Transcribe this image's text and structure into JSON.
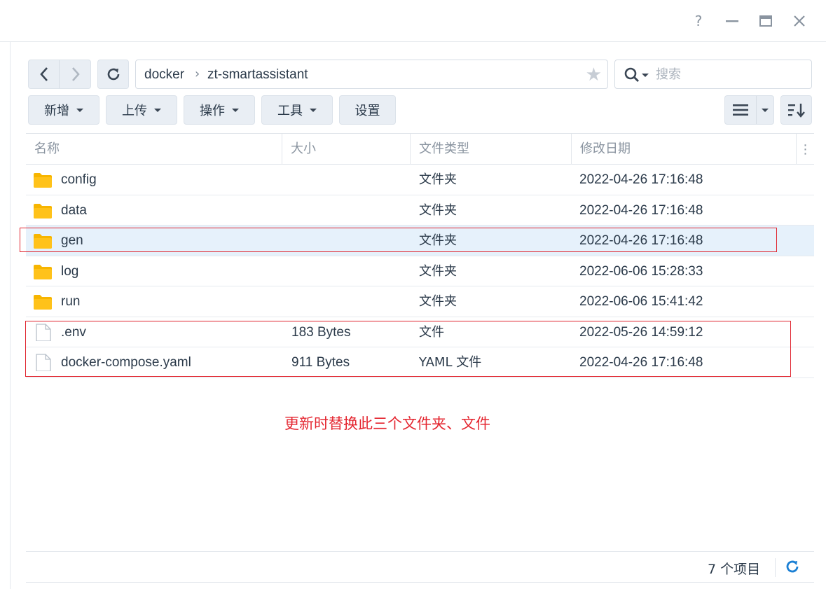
{
  "window": {
    "help_icon": "?",
    "minimize_icon": "minimize-icon",
    "maximize_icon": "maximize-icon",
    "close_icon": "close-icon"
  },
  "nav": {
    "path": [
      "docker",
      "zt-smartassistant"
    ],
    "path_separator": "›",
    "search_placeholder": "搜索"
  },
  "toolbar": {
    "buttons": [
      {
        "label": "新增",
        "dropdown": true
      },
      {
        "label": "上传",
        "dropdown": true
      },
      {
        "label": "操作",
        "dropdown": true
      },
      {
        "label": "工具",
        "dropdown": true
      },
      {
        "label": "设置",
        "dropdown": false
      }
    ]
  },
  "table": {
    "columns": [
      "名称",
      "大小",
      "文件类型",
      "修改日期"
    ],
    "rows": [
      {
        "name": "config",
        "size": "",
        "type": "文件夹",
        "date": "2022-04-26 17:16:48",
        "kind": "folder"
      },
      {
        "name": "data",
        "size": "",
        "type": "文件夹",
        "date": "2022-04-26 17:16:48",
        "kind": "folder"
      },
      {
        "name": "gen",
        "size": "",
        "type": "文件夹",
        "date": "2022-04-26 17:16:48",
        "kind": "folder",
        "selected": true
      },
      {
        "name": "log",
        "size": "",
        "type": "文件夹",
        "date": "2022-06-06 15:28:33",
        "kind": "folder"
      },
      {
        "name": "run",
        "size": "",
        "type": "文件夹",
        "date": "2022-06-06 15:41:42",
        "kind": "folder"
      },
      {
        "name": ".env",
        "size": "183 Bytes",
        "type": "文件",
        "date": "2022-05-26 14:59:12",
        "kind": "file"
      },
      {
        "name": "docker-compose.yaml",
        "size": "911 Bytes",
        "type": "YAML 文件",
        "date": "2022-04-26 17:16:48",
        "kind": "file"
      }
    ]
  },
  "annotation": {
    "note": "更新时替换此三个文件夹、文件",
    "color": "#e4252f"
  },
  "footer": {
    "count": "7 个项目"
  },
  "colors": {
    "folder": "#f7b500",
    "selected_row": "#e6f1fb",
    "accent": "#1a7fd4"
  }
}
